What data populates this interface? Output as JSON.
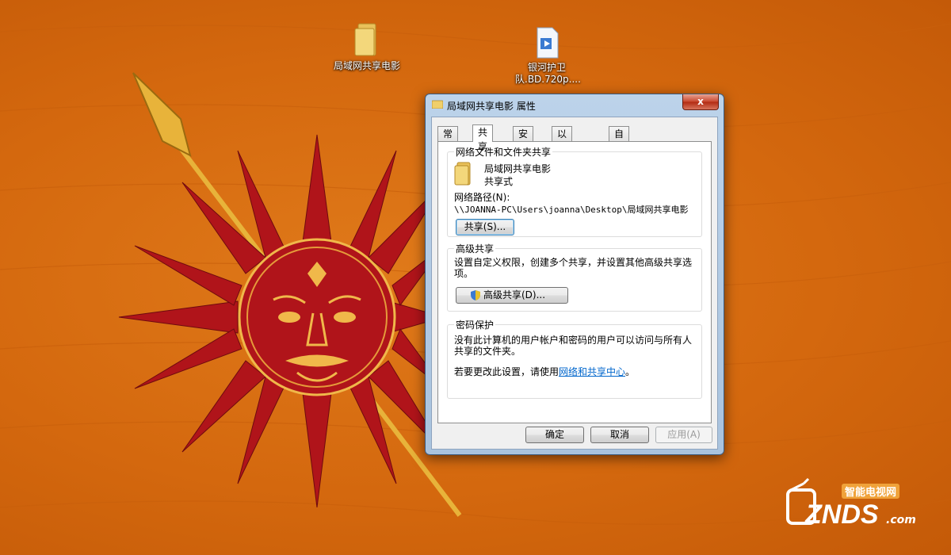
{
  "desktop": {
    "icons": [
      {
        "label": "局域网共享电影",
        "icon": "folder-icon"
      },
      {
        "label": "银河护卫队.BD.720p....",
        "icon": "video-file-icon"
      }
    ]
  },
  "dialog": {
    "title": "局域网共享电影 属性",
    "close_label": "x",
    "tabs": [
      {
        "label": "常规"
      },
      {
        "label": "共享",
        "active": true
      },
      {
        "label": "安全"
      },
      {
        "label": "以前的版本"
      },
      {
        "label": "自定义"
      }
    ],
    "network_sharing": {
      "group_title": "网络文件和文件夹共享",
      "folder_name": "局域网共享电影",
      "share_state": "共享式",
      "path_label": "网络路径(N):",
      "path_value": "\\\\JOANNA-PC\\Users\\joanna\\Desktop\\局域网共享电影",
      "share_button": "共享(S)..."
    },
    "advanced_sharing": {
      "group_title": "高级共享",
      "description": "设置自定义权限，创建多个共享，并设置其他高级共享选项。",
      "button": "高级共享(D)..."
    },
    "password_protection": {
      "group_title": "密码保护",
      "description": "没有此计算机的用户帐户和密码的用户可以访问与所有人共享的文件夹。",
      "change_text": "若要更改此设置，请使用",
      "link_text": "网络和共享中心",
      "suffix": "。"
    },
    "buttons": {
      "ok": "确定",
      "cancel": "取消",
      "apply": "应用(A)"
    }
  },
  "watermark": {
    "top_text": "智能电视网",
    "brand": "ZNDS",
    "suffix": ".com"
  },
  "colors": {
    "desktop_bg": "#d4680e",
    "sun_red": "#b0141a",
    "link": "#0066cc"
  }
}
